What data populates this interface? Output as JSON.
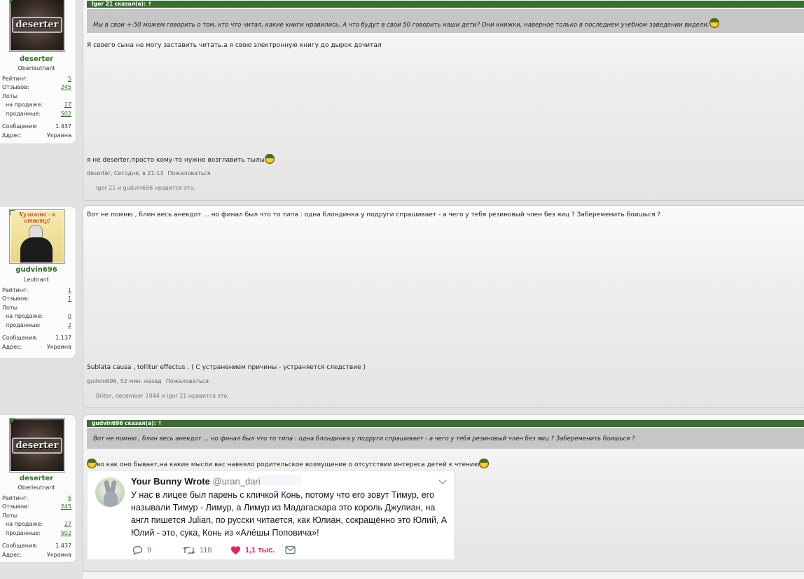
{
  "posts": [
    {
      "author": {
        "name": "deserter",
        "rank": "Oberleutnant",
        "avatar_text": "deserter"
      },
      "stats": {
        "rating_label": "Рейтинг:",
        "rating": "5",
        "reviews_label": "Отзывов:",
        "reviews": "245",
        "lots_label": "Лоты",
        "on_sale_label": "на продаже:",
        "on_sale": "27",
        "sold_label": "проданные:",
        "sold": "502",
        "messages_label": "Сообщения:",
        "messages": "1.437",
        "address_label": "Адрес:",
        "address": "Украина"
      },
      "quote": {
        "header": "Igor 21 сказал(а): ↑",
        "text": "Мы в свои +-50 можем говорить о том, кто что читал, какие книги нравились. А что будут в свои 50 говорить наши дети? Они книжки, наверное только в последнем учебном заведении видели."
      },
      "line1": "Я своего сына не могу заставить читать.а я свою электронную книгу до дырок дочитал",
      "line2": "я не deserter,просто кому-то нужно возглавить тылы",
      "meta": "deserter, Сегодня, в 21:13",
      "report": "Пожаловаться",
      "likes": "Igor 21 и gudvin696 нравится это."
    },
    {
      "author": {
        "name": "gudvin696",
        "rank": "Leutnant",
        "avatar_caption": "Хулигана - к ответу!"
      },
      "stats": {
        "rating_label": "Рейтинг:",
        "rating": "1",
        "reviews_label": "Отзывов:",
        "reviews": "1",
        "lots_label": "Лоты",
        "on_sale_label": "на продаже:",
        "on_sale": "0",
        "sold_label": "проданные:",
        "sold": "2",
        "messages_label": "Сообщения:",
        "messages": "1.137",
        "address_label": "Адрес:",
        "address": "Украина"
      },
      "line1": "Вот не помню , блин весь анекдот ... но финал был что то типа : одна блондинка у подруги спрашивает - а чего у тебя резиновый член без яиц ? Забеременить боишься ?",
      "line2": "Sublata causa , tollitur effectus . ( С устранением причины - устраняется следствие )",
      "meta": "gudvin696, 52 мин. назад",
      "report": "Пожаловаться",
      "likes": "Briter, december 1944 и Igor 21 нравится это."
    },
    {
      "author": {
        "name": "deserter",
        "rank": "Oberleutnant",
        "avatar_text": "deserter"
      },
      "stats": {
        "rating_label": "Рейтинг:",
        "rating": "5",
        "reviews_label": "Отзывов:",
        "reviews": "245",
        "lots_label": "Лоты",
        "on_sale_label": "на продаже:",
        "on_sale": "27",
        "sold_label": "проданные:",
        "sold": "502",
        "messages_label": "Сообщения:",
        "messages": "1.437",
        "address_label": "Адрес:",
        "address": "Украина"
      },
      "quote": {
        "header": "gudvin696 сказал(а): ↑",
        "text": "Вот не помню , блин весь анекдот ... но финал был что то типа : одна блондинка у подруги спрашивает - а чего у тебя резиновый член без яиц ? Забеременить боишься ?"
      },
      "line1": "во как оно бывает,на какие мысли вас навеяло родительское возмущение о отсутствии интереса детей к чтению",
      "tweet": {
        "name": "Your Bunny Wrote",
        "handle": "@uran_darin",
        "text": "У нас в лицее был парень с кличкой Конь, потому что его зовут Тимур, его называли Тимур  - Лимур, а Лимур из Мадагаскара это король Джулиан, на англ пишется Julian, по русски читается, как Юлиан, сокращённо это Юлий, А Юлий - это, сука, Конь из «Алёшы Поповича»!",
        "replies": "9",
        "retweets": "118",
        "likes": "1,1 тыс."
      }
    }
  ]
}
